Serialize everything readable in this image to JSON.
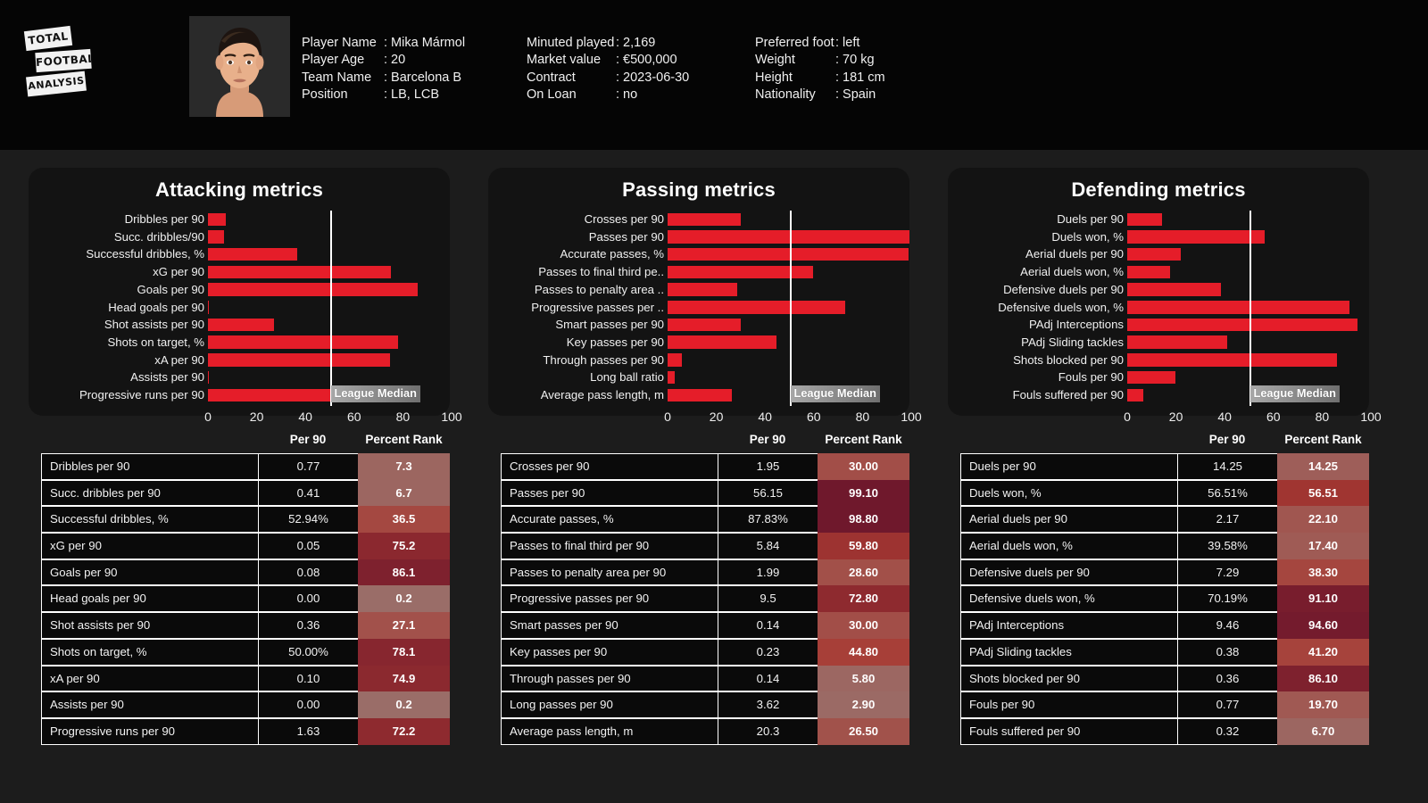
{
  "brand": {
    "line1": "TOTAL",
    "line2": "FOOTBALL",
    "line3": "ANALYSIS",
    "logo_icon": "total-football-analysis-logo"
  },
  "player": {
    "photo_icon": "player-portrait",
    "col1": [
      {
        "key": "Player Name",
        "value": ": Mika Mármol"
      },
      {
        "key": "Player Age",
        "value": ": 20"
      },
      {
        "key": "Team Name",
        "value": ": Barcelona B"
      },
      {
        "key": "Position",
        "value": ": LB, LCB"
      }
    ],
    "col2": [
      {
        "key": "Minuted played",
        "value": ": 2,169"
      },
      {
        "key": "Market value",
        "value": ": €500,000"
      },
      {
        "key": "Contract",
        "value": ": 2023-06-30"
      },
      {
        "key": "On Loan",
        "value": ": no"
      }
    ],
    "col3": [
      {
        "key": "Preferred foot",
        "value": ": left"
      },
      {
        "key": "Weight",
        "value": ": 70 kg"
      },
      {
        "key": "Height",
        "value": ": 181 cm"
      },
      {
        "key": "Nationality",
        "value": ": Spain"
      }
    ]
  },
  "colors": {
    "bar": "#e51d29",
    "median_line": "#ffffff",
    "panel_bg": "#131313",
    "page_bg": "#1c1c1c",
    "header_bg": "#050505",
    "rank_low": "#9a6d68",
    "rank_mid": "#a83a32",
    "rank_high": "#6e172c"
  },
  "axis": {
    "ticks": [
      "0",
      "20",
      "40",
      "60",
      "80",
      "100"
    ],
    "min": 0,
    "max": 100
  },
  "median_label": "League Median",
  "median_value": 50,
  "table_headers": {
    "metric": "",
    "per90": "Per 90",
    "rank": "Percent Rank"
  },
  "chart_data": [
    {
      "type": "bar",
      "title": "Attacking metrics",
      "xlabel": "",
      "ylabel": "",
      "xlim": [
        0,
        100
      ],
      "grid": false,
      "legend": "League Median",
      "orientation": "horizontal",
      "categories": [
        "Dribbles per 90",
        "Succ. dribbles/90",
        "Successful dribbles, %",
        "xG per 90",
        "Goals per 90",
        "Head goals per 90",
        "Shot assists per 90",
        "Shots on target, %",
        "xA per 90",
        "Assists per 90",
        "Progressive runs per 90"
      ],
      "values": [
        7.3,
        6.7,
        36.5,
        75.2,
        86.1,
        0.2,
        27.1,
        78.1,
        74.9,
        0.2,
        72.2
      ],
      "table": {
        "metrics": [
          "Dribbles per 90",
          "Succ. dribbles per 90",
          "Successful dribbles, %",
          "xG per 90",
          "Goals per 90",
          "Head goals per 90",
          "Shot assists per 90",
          "Shots on target, %",
          "xA per 90",
          "Assists per 90",
          "Progressive runs per 90"
        ],
        "per90": [
          "0.77",
          "0.41",
          "52.94%",
          "0.05",
          "0.08",
          "0.00",
          "0.36",
          "50.00%",
          "0.10",
          "0.00",
          "1.63"
        ],
        "rank": [
          "7.3",
          "6.7",
          "36.5",
          "75.2",
          "86.1",
          "0.2",
          "27.1",
          "78.1",
          "74.9",
          "0.2",
          "72.2"
        ]
      }
    },
    {
      "type": "bar",
      "title": "Passing metrics",
      "xlabel": "",
      "ylabel": "",
      "xlim": [
        0,
        100
      ],
      "grid": false,
      "legend": "League Median",
      "orientation": "horizontal",
      "categories": [
        "Crosses per 90",
        "Passes per 90",
        "Accurate passes, %",
        "Passes to final third pe..",
        "Passes to penalty area ..",
        "Progressive passes per ..",
        "Smart passes per 90",
        "Key passes per 90",
        "Through passes per 90",
        "Long ball ratio",
        "Average pass length, m"
      ],
      "values": [
        30.0,
        99.1,
        98.8,
        59.8,
        28.6,
        72.8,
        30.0,
        44.8,
        5.8,
        2.9,
        26.5
      ],
      "table": {
        "metrics": [
          "Crosses per 90",
          "Passes per 90",
          "Accurate passes, %",
          "Passes to final third per 90",
          "Passes to penalty area per 90",
          "Progressive passes per 90",
          "Smart passes per 90",
          "Key passes per 90",
          "Through passes per 90",
          "Long passes per 90",
          "Average pass length, m"
        ],
        "per90": [
          "1.95",
          "56.15",
          "87.83%",
          "5.84",
          "1.99",
          "9.5",
          "0.14",
          "0.23",
          "0.14",
          "3.62",
          "20.3"
        ],
        "rank": [
          "30.00",
          "99.10",
          "98.80",
          "59.80",
          "28.60",
          "72.80",
          "30.00",
          "44.80",
          "5.80",
          "2.90",
          "26.50"
        ]
      }
    },
    {
      "type": "bar",
      "title": "Defending metrics",
      "xlabel": "",
      "ylabel": "",
      "xlim": [
        0,
        100
      ],
      "grid": false,
      "legend": "League Median",
      "orientation": "horizontal",
      "categories": [
        "Duels per 90",
        "Duels won, %",
        "Aerial duels per 90",
        "Aerial duels won, %",
        "Defensive duels per 90",
        "Defensive duels won, %",
        "PAdj Interceptions",
        "PAdj Sliding tackles",
        "Shots blocked per 90",
        "Fouls per 90",
        "Fouls suffered per 90"
      ],
      "values": [
        14.25,
        56.51,
        22.1,
        17.4,
        38.3,
        91.1,
        94.6,
        41.2,
        86.1,
        19.7,
        6.7
      ],
      "table": {
        "metrics": [
          "Duels per 90",
          "Duels won, %",
          "Aerial duels per 90",
          "Aerial duels won, %",
          "Defensive duels per 90",
          "Defensive duels won, %",
          "PAdj Interceptions",
          "PAdj Sliding tackles",
          "Shots blocked per 90",
          "Fouls per 90",
          "Fouls suffered per 90"
        ],
        "per90": [
          "14.25",
          "56.51%",
          "2.17",
          "39.58%",
          "7.29",
          "70.19%",
          "9.46",
          "0.38",
          "0.36",
          "0.77",
          "0.32"
        ],
        "rank": [
          "14.25",
          "56.51",
          "22.10",
          "17.40",
          "38.30",
          "91.10",
          "94.60",
          "41.20",
          "86.10",
          "19.70",
          "6.70"
        ]
      }
    }
  ]
}
